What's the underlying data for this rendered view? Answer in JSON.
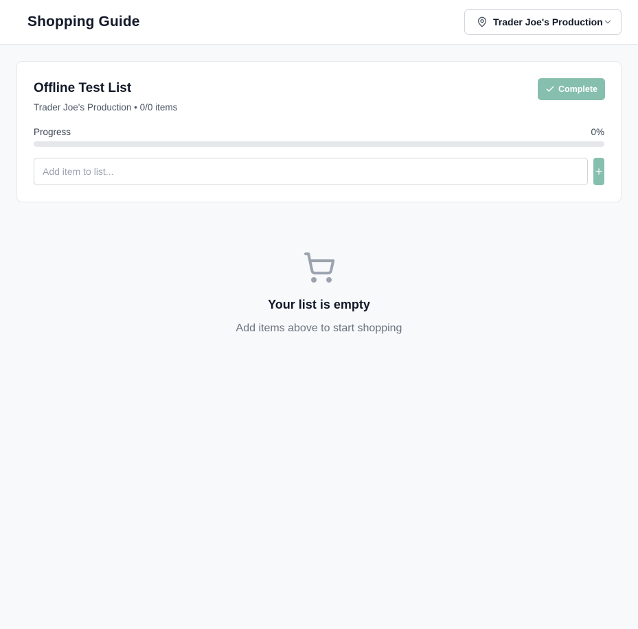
{
  "header": {
    "title": "Shopping Guide",
    "store_selector": {
      "label": "Trader Joe's Production",
      "icon": "map-pin-icon",
      "chevron_icon": "chevron-down-icon"
    }
  },
  "list": {
    "title": "Offline Test List",
    "subtitle": "Trader Joe's Production • 0/0 items",
    "complete_button": "Complete",
    "progress_label": "Progress",
    "progress_value": "0%",
    "progress_fraction": 0,
    "add_item_placeholder": "Add item to list...",
    "add_button_icon": "plus-icon"
  },
  "empty_state": {
    "icon": "shopping-cart-icon",
    "title": "Your list is empty",
    "subtitle": "Add items above to start shopping"
  },
  "colors": {
    "accent": "#86bfad",
    "background": "#f8f9fb",
    "border": "#e5e7eb"
  }
}
